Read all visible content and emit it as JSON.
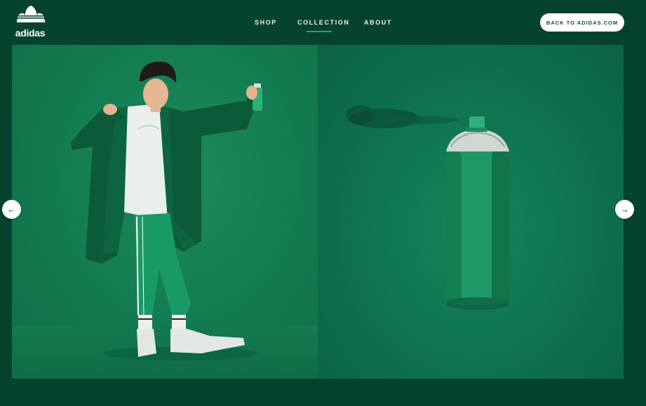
{
  "brand": {
    "logo_text": "adidas",
    "logo_icon": "trefoil-icon"
  },
  "nav": {
    "items": [
      {
        "label": "SHOP"
      },
      {
        "label": "COLLECTION"
      },
      {
        "label": "ABOUT"
      }
    ],
    "active_index": 1
  },
  "header": {
    "back_label": "BACK TO ADIDAS.COM"
  },
  "hero": {
    "left_image": "model-with-spray-can-photo",
    "right_image": "spray-can-photo"
  },
  "carousel": {
    "prev_icon": "arrow-left-icon",
    "next_icon": "arrow-right-icon",
    "prev_glyph": "←",
    "next_glyph": "→"
  },
  "colors": {
    "background": "#05432f",
    "panel_green": "#137a50",
    "accent_underline": "#3d9a76",
    "button_bg": "#ffffff",
    "button_text": "#0d4a35"
  }
}
